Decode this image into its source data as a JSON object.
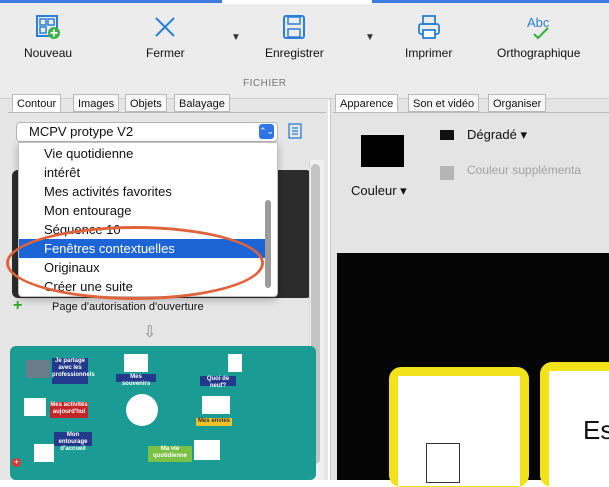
{
  "toolbar": {
    "nouveau": "Nouveau",
    "fermer": "Fermer",
    "enregistrer": "Enregistrer",
    "imprimer": "Imprimer",
    "orthographique": "Orthographique",
    "group_label": "FICHIER",
    "icons": [
      "new-grid-icon",
      "close-x-icon",
      "save-disk-icon",
      "printer-icon",
      "spellcheck-icon"
    ],
    "accent_color": "#3d7be0"
  },
  "left_tabs": [
    "Contour",
    "Images",
    "Objets",
    "Balayage"
  ],
  "select": {
    "value": "MCPV protype V2"
  },
  "dropdown": {
    "options": [
      "Vie quotidienne",
      "intérêt",
      "Mes activités favorites",
      "Mon entourage",
      "Séquence 10",
      "Fenêtres contextuelles",
      "Originaux",
      "Créer une suite"
    ],
    "selected_index": 5,
    "highlight_color": "#1d64d6",
    "annotation_color": "#e0633b"
  },
  "pages": {
    "auth_label": "Page d'autorisation d'ouverture",
    "thumbnail_cards": [
      "Je partage avec les professionnels",
      "Mes souvenirs",
      "Quoi de neuf?",
      "Mes activités aujourd'hui",
      "Mes envies",
      "Mon entourage d'accueil",
      "Ma vie quotidienne"
    ],
    "thumbnail_color": "#1a9b93"
  },
  "right_tabs": [
    "Apparence",
    "Son et vidéo",
    "Organiser"
  ],
  "appearance": {
    "couleur_label": "Couleur",
    "degrade_label": "Dégradé",
    "supplementaire_label": "Couleur supplémenta"
  },
  "preview": {
    "text": "Es",
    "frame_color": "#f2e21a"
  }
}
